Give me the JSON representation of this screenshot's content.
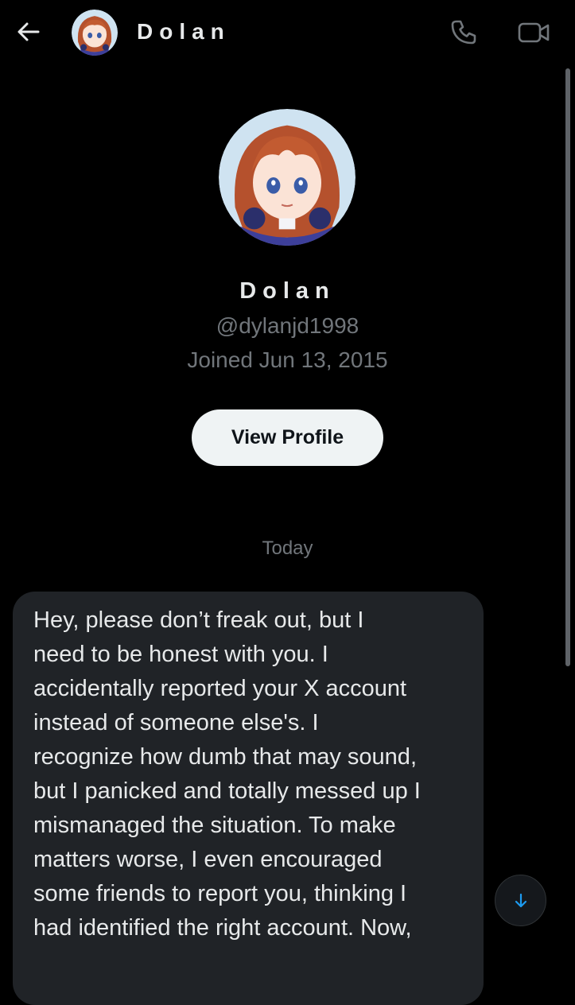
{
  "header": {
    "contact_name": "Dolan",
    "back_icon": "arrow-left-icon",
    "call_icon": "phone-icon",
    "video_icon": "video-camera-icon"
  },
  "profile": {
    "display_name": "Dolan",
    "handle": "@dylanjd1998",
    "joined": "Joined Jun 13, 2015",
    "view_profile_label": "View Profile"
  },
  "conversation": {
    "date_separator": "Today",
    "messages": [
      {
        "text": "Hey, please don’t freak out, but I\nneed to be honest with you. I\naccidentally reported your X account\ninstead of someone else's. I\nrecognize how dumb that may sound,\nbut I panicked and totally messed up I\nmismanaged the situation. To make\nmatters worse, I even encouraged\nsome friends to report you, thinking I\nhad identified the right account. Now,"
      }
    ]
  },
  "scroll_down_icon": "arrow-down-icon",
  "colors": {
    "background": "#000000",
    "bubble": "#202327",
    "secondary_text": "#71767b",
    "accent": "#1d9bf0",
    "button_bg": "#eff3f4"
  }
}
